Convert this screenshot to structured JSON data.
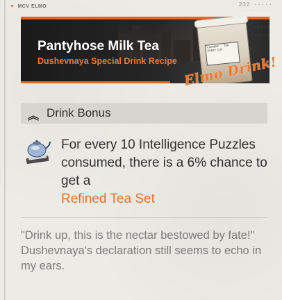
{
  "header": {
    "location": "MCV ELMO",
    "serial": "232 ·····",
    "serial_sub": "·· ··· ··· ··· ···"
  },
  "banner": {
    "title": "Pantyhose Milk Tea",
    "subtitle": "Dushevnaya Special Drink Recipe",
    "cup_label": "ELEMENT · TEA · EVERY CUP",
    "stamp": "Elmo Drink!"
  },
  "section": {
    "title": "Drink Bonus"
  },
  "bonus": {
    "text": "For every 10 Intelligence Puzzles consumed, there is a 6% chance to get a",
    "highlight": "Refined Tea Set"
  },
  "quote": {
    "text": "\"Drink up, this is the nectar bestowed by fate!\" Dushevnaya's declaration still seems to echo in my ears."
  },
  "colors": {
    "accent": "#e8732a",
    "background": "#ecebe6",
    "section_bar": "#d6d5d0"
  },
  "icons": {
    "section": "double-chevron-up-icon",
    "bonus": "teapot-icon"
  }
}
